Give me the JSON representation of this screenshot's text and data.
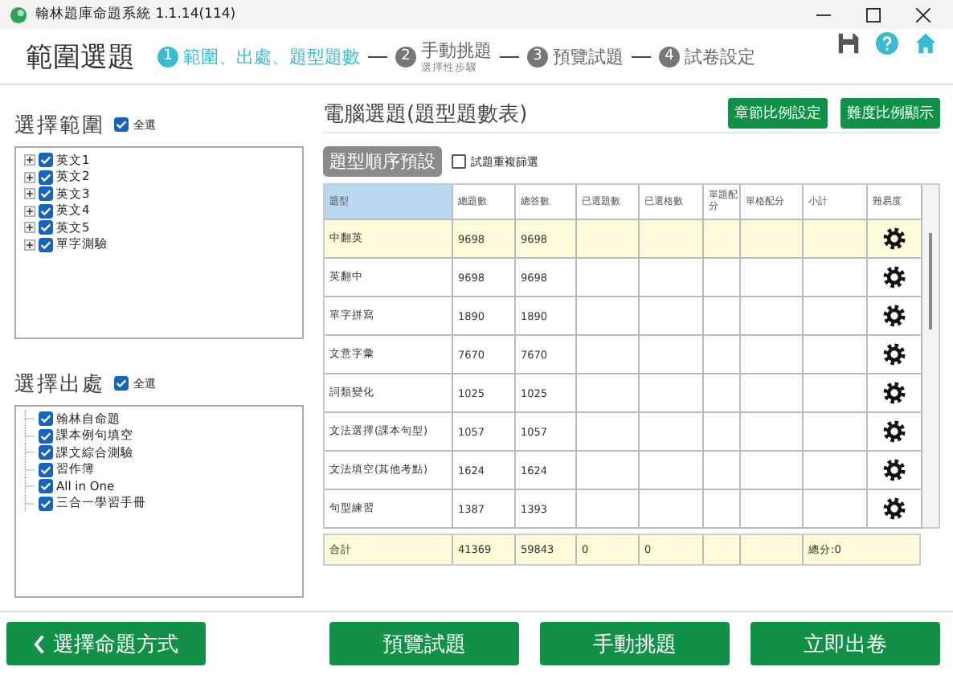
{
  "window": {
    "title": "翰林題庫命題系統 1.1.14(114)"
  },
  "header": {
    "title": "範圍選題",
    "steps": [
      {
        "number": "1",
        "label": "範圍、出處、題型題數",
        "selected": true
      },
      {
        "number": "2",
        "label": "手動挑題",
        "sublabel": "選擇性步驟",
        "selected": false
      },
      {
        "number": "3",
        "label": "預覽試題",
        "selected": false
      },
      {
        "number": "4",
        "label": "試卷設定",
        "selected": false
      }
    ]
  },
  "scope": {
    "title": "選擇範圍",
    "select_all": {
      "label": "全選",
      "checked": true
    },
    "items": [
      {
        "label": "英文1",
        "checked": true
      },
      {
        "label": "英文2",
        "checked": true
      },
      {
        "label": "英文3",
        "checked": true
      },
      {
        "label": "英文4",
        "checked": true
      },
      {
        "label": "英文5",
        "checked": true
      },
      {
        "label": "單字測驗",
        "checked": true
      }
    ]
  },
  "sources": {
    "title": "選擇出處",
    "select_all": {
      "label": "全選",
      "checked": true
    },
    "items": [
      {
        "label": "翰林自命題",
        "checked": true
      },
      {
        "label": "課本例句填空",
        "checked": true
      },
      {
        "label": "課文綜合測驗",
        "checked": true
      },
      {
        "label": "習作簿",
        "checked": true
      },
      {
        "label": "All in One",
        "checked": true
      },
      {
        "label": "三合一學習手冊",
        "checked": true
      }
    ]
  },
  "auto_select": {
    "title": "電腦選題(題型題數表)",
    "buttons": [
      "章節比例設定",
      "難度比例顯示"
    ],
    "order_button": "題型順序預設",
    "dedupe": {
      "label": "試題重複篩選",
      "checked": false
    },
    "table": {
      "columns": [
        "題型",
        "總題數",
        "總答數",
        "已選題數",
        "已選格數",
        "單題配分",
        "單格配分",
        "小計",
        "難易度"
      ],
      "rows": [
        {
          "cells": [
            "中翻英",
            "9698",
            "9698"
          ],
          "selected": true
        },
        {
          "cells": [
            "英翻中",
            "9698",
            "9698"
          ],
          "selected": false
        },
        {
          "cells": [
            "單字拼寫",
            "1890",
            "1890"
          ],
          "selected": false
        },
        {
          "cells": [
            "文意字彙",
            "7670",
            "7670"
          ],
          "selected": false
        },
        {
          "cells": [
            "詞類變化",
            "1025",
            "1025"
          ],
          "selected": false
        },
        {
          "cells": [
            "文法選擇(課本句型)",
            "1057",
            "1057"
          ],
          "selected": false
        },
        {
          "cells": [
            "文法填空(其他考點)",
            "1624",
            "1624"
          ],
          "selected": false
        },
        {
          "cells": [
            "句型練習",
            "1387",
            "1393"
          ],
          "selected": false
        }
      ],
      "total": {
        "label": "合計",
        "cells": [
          "41369",
          "59843",
          "0",
          "0"
        ],
        "score": "總分:0"
      }
    }
  },
  "footer": {
    "back_button": "選擇命題方式",
    "buttons": [
      "預覽試題",
      "手動挑題",
      "立即出卷"
    ]
  }
}
